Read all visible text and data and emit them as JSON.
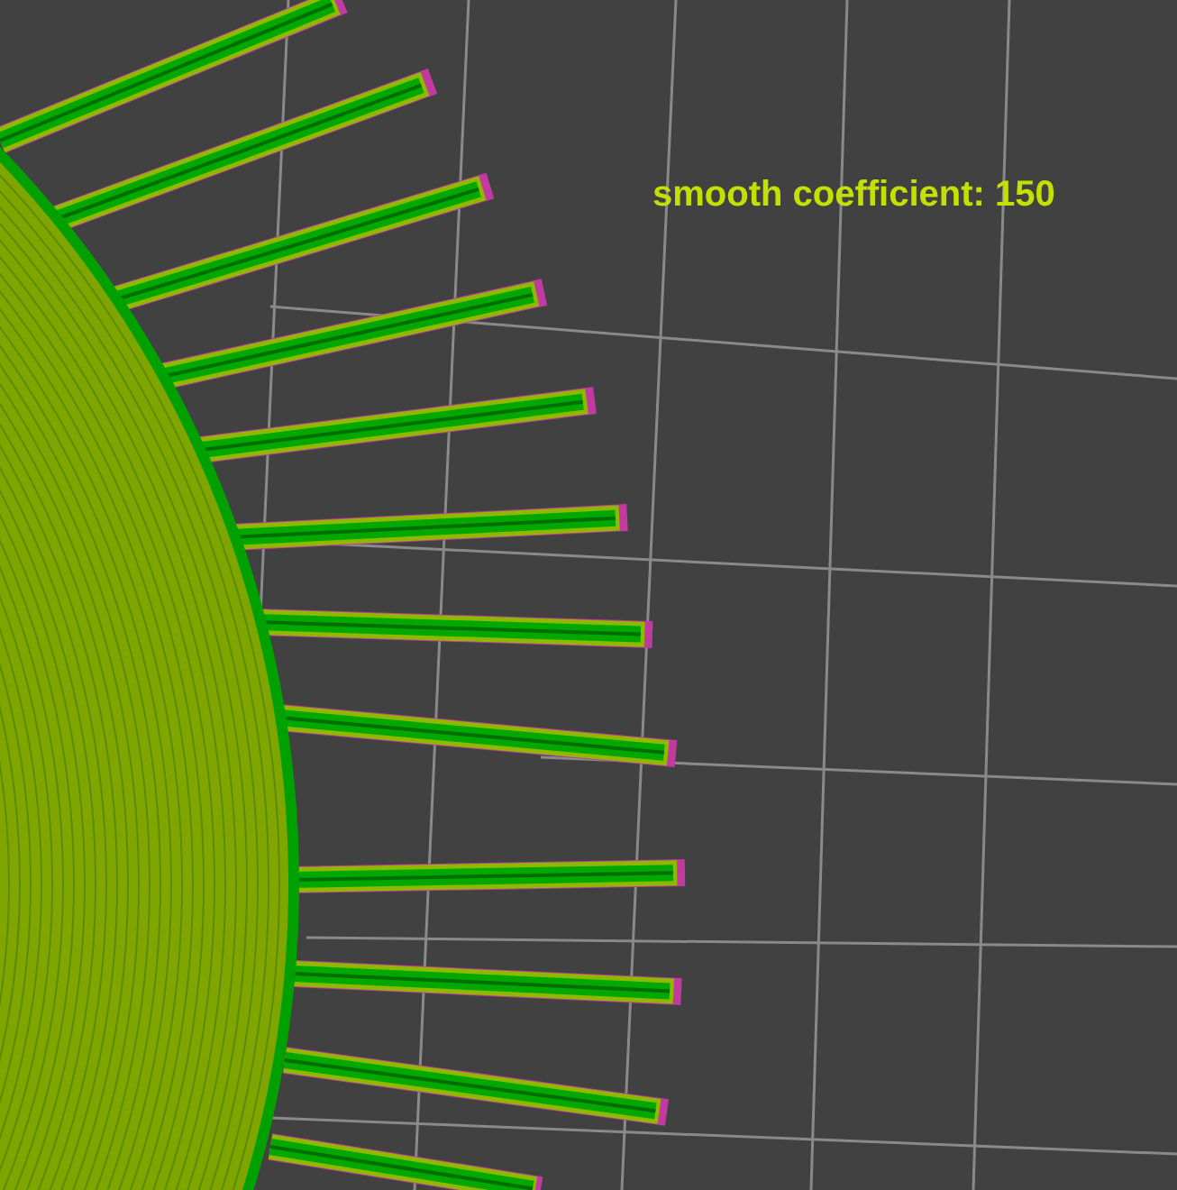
{
  "viewport": {
    "label": "smooth coefficient: 150"
  }
}
